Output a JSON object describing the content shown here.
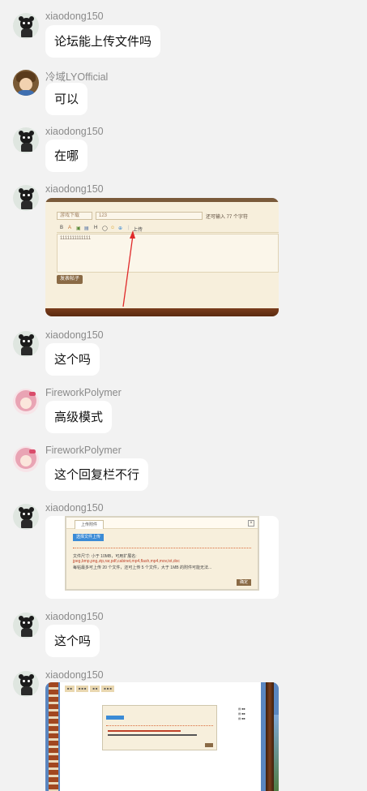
{
  "messages": [
    {
      "sender": "xiaodong150",
      "avatar": "panda-avatar",
      "text": "论坛能上传文件吗"
    },
    {
      "sender": "冷域LYOfficial",
      "avatar": "brown-hair-avatar",
      "text": "可以"
    },
    {
      "sender": "xiaodong150",
      "avatar": "panda-avatar",
      "text": "在哪"
    },
    {
      "sender": "xiaodong150",
      "avatar": "panda-avatar",
      "image": "forum-post-editor-screenshot"
    },
    {
      "sender": "xiaodong150",
      "avatar": "panda-avatar",
      "text": "这个吗"
    },
    {
      "sender": "FireworkPolymer",
      "avatar": "pink-hair-avatar",
      "text": "高级模式"
    },
    {
      "sender": "FireworkPolymer",
      "avatar": "pink-hair-avatar",
      "text": "这个回复栏不行"
    },
    {
      "sender": "xiaodong150",
      "avatar": "panda-avatar",
      "image": "upload-dialog-screenshot"
    },
    {
      "sender": "xiaodong150",
      "avatar": "panda-avatar",
      "text": "这个吗"
    },
    {
      "sender": "xiaodong150",
      "avatar": "panda-avatar",
      "image": "forum-page-with-upload-dialog-screenshot"
    }
  ],
  "shot1": {
    "category": "游戏下载",
    "title_value": "123",
    "char_hint": "还可输入 77 个字符",
    "toolbar_items": [
      "B",
      "A",
      "▣",
      "▤",
      "H",
      "◯",
      "☺",
      "⊕",
      "|",
      "上传"
    ],
    "editor_text": "1111111111111",
    "post_button": "发表帖子"
  },
  "shot2": {
    "dialog_tab": "上传附件",
    "select_button": "选择文件上传",
    "line1": "文件尺寸: 小于 10MB，可用扩展名:",
    "line2": "jpeg,bmp,png,zip,rar,pdf,cabinet,mp4,flash,mp4,mov,txt,doc",
    "line3": "每帖最多可上传 20 个文件，还可上传 5 个文件，大于 1MB 的附件可能无法...",
    "ok_button": "确定",
    "close": "×"
  },
  "shot3": {
    "tabs": [
      "■ ■",
      "■ ■ ■",
      "■ ■",
      "■ ■ ■"
    ],
    "side_lines": [
      "▤ ■■",
      "▤ ■■",
      "▤ ■■"
    ]
  },
  "colors": {
    "background": "#f2f2f2",
    "bubble": "#ffffff",
    "name": "#8a8a8a"
  }
}
